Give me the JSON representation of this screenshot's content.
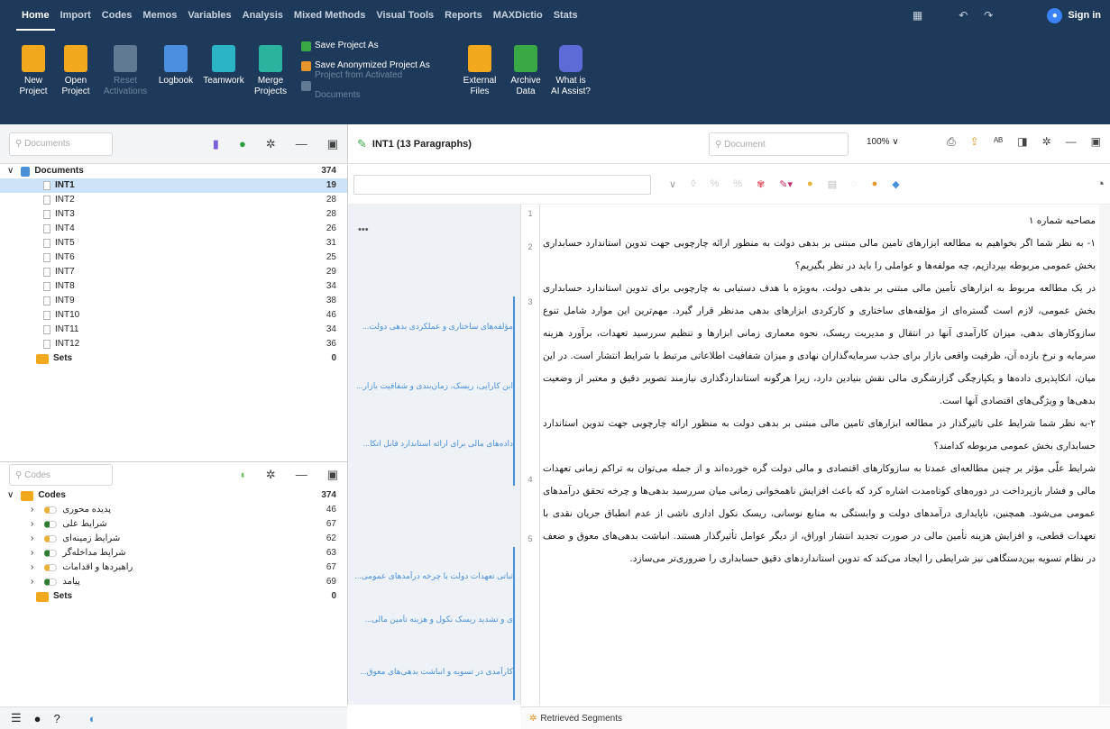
{
  "ribbon_tabs": [
    "Home",
    "Import",
    "Codes",
    "Memos",
    "Variables",
    "Analysis",
    "Mixed Methods",
    "Visual Tools",
    "Reports",
    "MAXDictio",
    "Stats"
  ],
  "account": {
    "sign_in": "Sign in"
  },
  "ribbon": {
    "new_project": "New Project",
    "open_project": "Open Project",
    "reset_activations": "Reset Activations",
    "logbook": "Logbook",
    "teamwork": "Teamwork",
    "merge_projects": "Merge Projects",
    "save_project_as": "Save Project As",
    "save_anonymized": "Save Anonymized Project As",
    "project_from_activated": "Project from Activated Documents",
    "external_files": "External Files",
    "archive_data": "Archive Data",
    "ai_assist": "What is AI Assist?"
  },
  "documents_panel": {
    "search_placeholder": "Documents",
    "root": {
      "label": "Documents",
      "count": "374"
    },
    "items": [
      {
        "label": "INT1",
        "count": "19"
      },
      {
        "label": "INT2",
        "count": "28"
      },
      {
        "label": "INT3",
        "count": "28"
      },
      {
        "label": "INT4",
        "count": "26"
      },
      {
        "label": "INT5",
        "count": "31"
      },
      {
        "label": "INT6",
        "count": "25"
      },
      {
        "label": "INT7",
        "count": "29"
      },
      {
        "label": "INT8",
        "count": "34"
      },
      {
        "label": "INT9",
        "count": "38"
      },
      {
        "label": "INT10",
        "count": "46"
      },
      {
        "label": "INT11",
        "count": "34"
      },
      {
        "label": "INT12",
        "count": "36"
      }
    ],
    "sets": {
      "label": "Sets",
      "count": "0"
    }
  },
  "codes_panel": {
    "search_placeholder": "Codes",
    "root": {
      "label": "Codes",
      "count": "374"
    },
    "items": [
      {
        "label": "پدیده محوری",
        "count": "46",
        "color": "#e8b23a"
      },
      {
        "label": "شرایط علی",
        "count": "67",
        "color": "#2e7d32"
      },
      {
        "label": "شرایط زمینه‌ای",
        "count": "62",
        "color": "#e8b23a"
      },
      {
        "label": "شرایط مداخله‌گر",
        "count": "63",
        "color": "#2e7d32"
      },
      {
        "label": "راهبردها و اقدامات",
        "count": "67",
        "color": "#e8b23a"
      },
      {
        "label": "پیامد",
        "count": "69",
        "color": "#2e7d32"
      }
    ],
    "sets": {
      "label": "Sets",
      "count": "0"
    }
  },
  "document_view": {
    "title": "INT1  (13 Paragraphs)",
    "search_placeholder": "Document",
    "zoom": "100%",
    "memo_dots": "•••",
    "segments": [
      "مؤلفه‌های ساختاری و عملکردی بدهی دولت...",
      "ابن کارایی، ریسک، زمان‌بندی و شفافیت بازار...",
      "داده‌های مالی برای ارائه استاندارد قابل اتکا...",
      "ثباتی تعهدات دولت با چرخه درآمدهای عمومی...",
      "ی و تشدید ریسک نکول و هزینه تأمین مالی...",
      "کارآمدی در تسویه و انباشت بدهی‌های معوق..."
    ],
    "paragraphs": [
      {
        "no": "1",
        "text": "مصاحبه شماره ۱"
      },
      {
        "no": "2",
        "text": "۱- به نظر شما اگر بخواهیم به مطالعه ابزارهای تامین مالی مبتنی بر بدهی دولت به منظور ارائه چارچوبی جهت تدوین استاندارد حسابداری بخش عمومی مربوطه بپردازیم، چه مولفه‌ها و عواملی را باید در نظر بگیریم؟"
      },
      {
        "no": "3",
        "text": "در یک مطالعه مربوط به ابزارهای تأمین مالی مبتنی بر بدهی دولت، به‌ویژه با هدف دستیابی به چارچوبی برای تدوین استاندارد حسابداری بخش عمومی، لازم است گستره‌ای از مؤلفه‌های ساختاری و کارکردی ابزارهای بدهی مدنظر قرار گیرد. مهم‌ترین این موارد شامل تنوع سازوکارهای بدهی، میزان کارآمدی آنها در انتقال و مدیریت ریسک، نحوه معماری زمانی ابزارها و تنظیم سررسید تعهدات، برآورد هزینه سرمایه و نرخ بازده آن، ظرفیت واقعی بازار برای جذب سرمایه‌گذاران نهادی و میزان شفافیت اطلاعاتی مرتبط با شرایط انتشار است. در این میان، انکاپذیری داده‌ها و یکپارچگی گزارشگری مالی نقش بنیادین دارد، زیرا هرگونه استانداردگذاری نیازمند تصویر دقیق و معتبر از وضعیت بدهی‌ها و ویژگی‌های اقتصادی آنها است."
      },
      {
        "no": "4",
        "text": "۲-به نظر شما شرایط علی تاثیرگذار در مطالعه ابزارهای تامین مالی مبتنی بر بدهی دولت به منظور ارائه چارچوبی جهت تدوین استاندارد حسابداری بخش عمومی مربوطه کدامند؟"
      },
      {
        "no": "5",
        "text": "شرایط علّی مؤثر بر چنین مطالعه‌ای عمدتا به سازوکارهای اقتصادی و مالی دولت گره خورده‌اند و از جمله می‌توان به تراکم زمانی تعهدات مالی و فشار بازپرداخت در دوره‌های کوتاه‌مدت اشاره کرد که باعث افزایش ناهمخوانی زمانی میان سررسید بدهی‌ها و چرخه تحقق درآمدهای عمومی می‌شود. همچنین، ناپایداری درآمدهای دولت و وابستگی به منابع نوسانی، ریسک نکول اداری ناشی از عدم انطباق جریان نقدی با تعهدات قطعی، و افزایش هزینه تأمین مالی در صورت تجدید انتشار اوراق، از دیگر عوامل تأثیرگذار هستند. انباشت بدهی‌های معوق و ضعف در نظام تسویه بین‌دستگاهی نیز شرایطی را ایجاد می‌کند که تدوین استانداردهای دقیق حسابداری را ضروری‌تر می‌سازد."
      }
    ]
  },
  "retrieved_segments": "Retrieved Segments"
}
